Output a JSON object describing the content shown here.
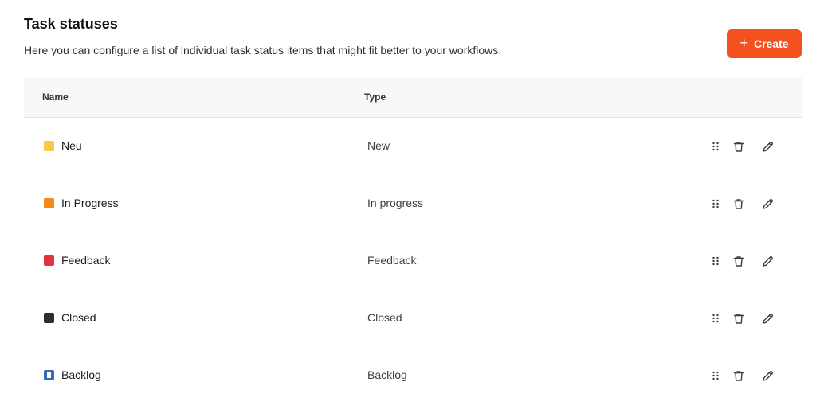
{
  "header": {
    "title": "Task statuses",
    "description": "Here you can configure a list of individual task status items that might fit better to your workflows.",
    "create_label": "Create",
    "create_icon": "plus-icon"
  },
  "table": {
    "columns": {
      "name": "Name",
      "type": "Type"
    },
    "rows": [
      {
        "name": "Neu",
        "type": "New",
        "color": "#f7c948"
      },
      {
        "name": "In Progress",
        "type": "In progress",
        "color": "#f28c18"
      },
      {
        "name": "Feedback",
        "type": "Feedback",
        "color": "#e0323f"
      },
      {
        "name": "Closed",
        "type": "Closed",
        "color": "#2b2f33"
      },
      {
        "name": "Backlog",
        "type": "Backlog",
        "color": "#2f6fb0"
      }
    ],
    "row_actions": [
      "drag-handle-icon",
      "trash-icon",
      "pencil-icon"
    ]
  },
  "colors": {
    "accent": "#f4511e"
  }
}
